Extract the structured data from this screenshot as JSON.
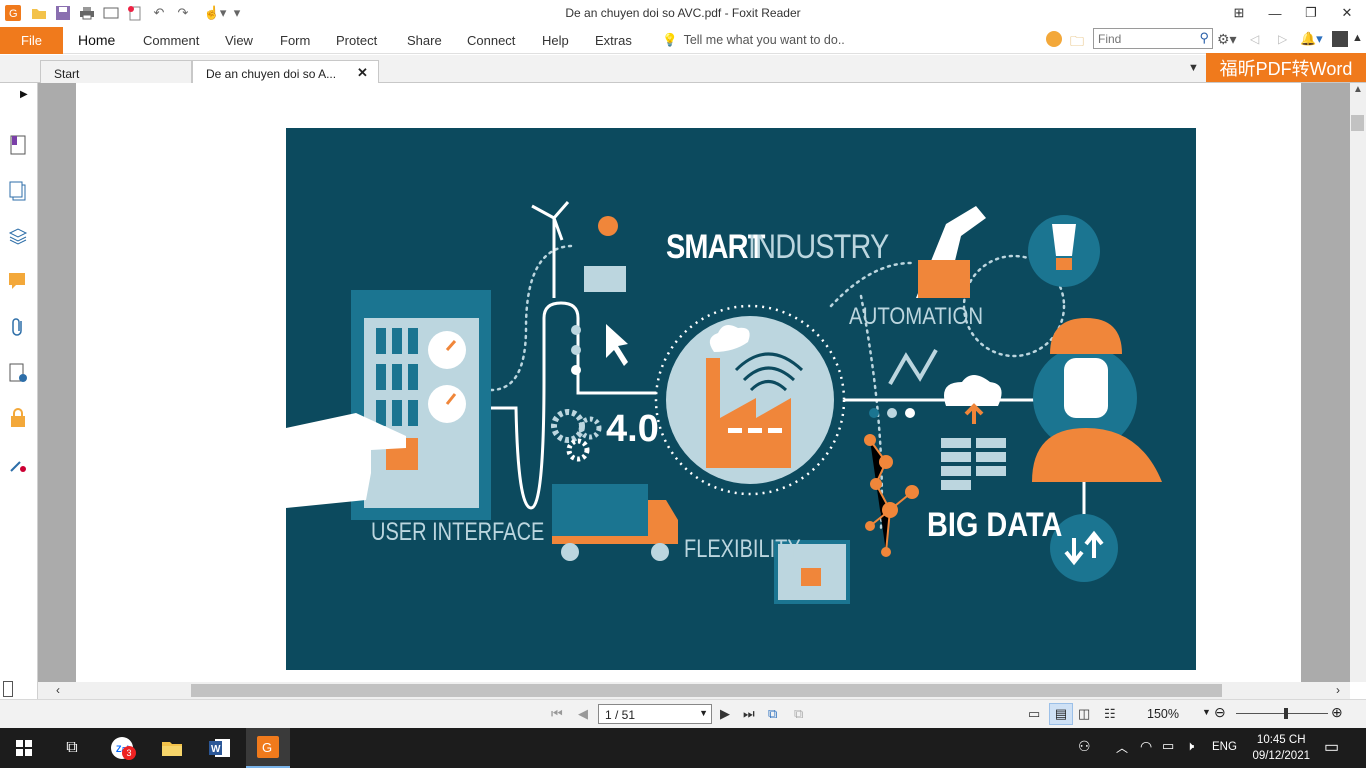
{
  "window": {
    "title": "De an chuyen doi so AVC.pdf - Foxit Reader"
  },
  "menu": {
    "file": "File",
    "items": [
      "Home",
      "Comment",
      "View",
      "Form",
      "Protect",
      "Share",
      "Connect",
      "Help",
      "Extras"
    ],
    "tell_me": "Tell me what you want to do..",
    "find_placeholder": "Find"
  },
  "tabs": [
    {
      "label": "Start",
      "active": false
    },
    {
      "label": "De an chuyen doi so A...",
      "active": true
    }
  ],
  "promo": {
    "label": "福昕PDF转Word"
  },
  "infographic": {
    "title_bold": "SMART",
    "title_light": "INDUSTRY",
    "labels": {
      "automation": "AUTOMATION",
      "version": "4.0",
      "user_interface": "USER INTERFACE",
      "flexibility": "FLEXIBILITY",
      "big_data": "BIG DATA"
    },
    "colors": {
      "bg": "#0c4a5e",
      "orange": "#f0863a",
      "light": "#bcd6df",
      "teal": "#1b7591"
    }
  },
  "status": {
    "page_indicator": "1 / 51",
    "zoom": "150%"
  },
  "taskbar": {
    "zalo_badge": "3",
    "lang": "ENG",
    "time": "10:45 CH",
    "date": "09/12/2021"
  }
}
